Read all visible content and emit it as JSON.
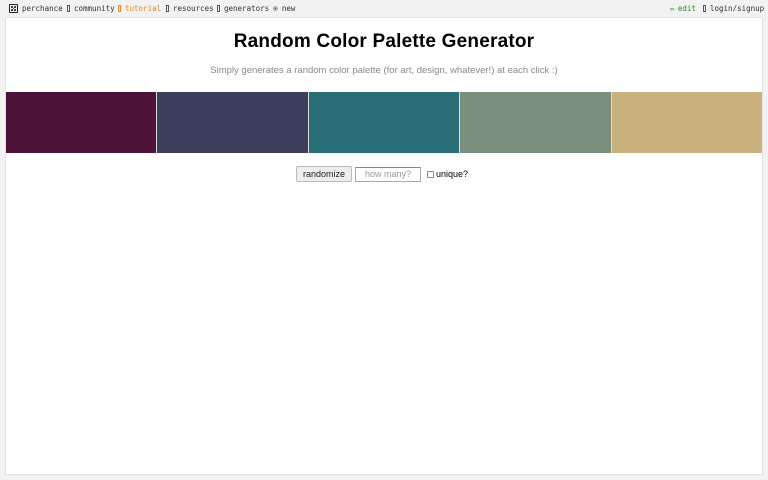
{
  "topbar": {
    "left": [
      {
        "label": "perchance",
        "icon": "dice-icon"
      },
      {
        "label": "community",
        "icon": "community-icon"
      },
      {
        "label": "tutorial",
        "icon": "tutorial-icon"
      },
      {
        "label": "resources",
        "icon": "resources-icon"
      },
      {
        "label": "generators",
        "icon": "generators-icon"
      },
      {
        "label": "new",
        "icon": "plus-circle-icon",
        "glyph": "⊕"
      }
    ],
    "right": [
      {
        "label": "edit",
        "icon": "pencil-icon",
        "glyph": "✏"
      },
      {
        "label": "login/signup",
        "icon": "user-icon"
      }
    ],
    "colors": {
      "accent_tutorial": "#e08a2c",
      "accent_edit": "#2e8b2e"
    }
  },
  "page": {
    "title": "Random Color Palette Generator",
    "subtitle": "Simply generates a random color palette (for art, design, whatever!) at each click :)"
  },
  "palette": [
    {
      "color": "#4d1237"
    },
    {
      "color": "#3c3e5b"
    },
    {
      "color": "#296e77"
    },
    {
      "color": "#7b907c"
    },
    {
      "color": "#c9b27e"
    }
  ],
  "controls": {
    "randomize_label": "randomize",
    "count_placeholder": "how many?",
    "unique_label": "unique?",
    "unique_checked": false
  }
}
